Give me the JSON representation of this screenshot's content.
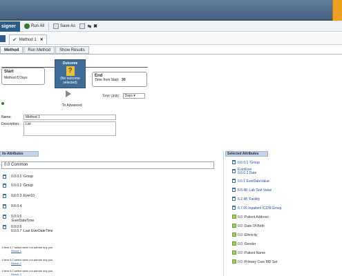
{
  "toolbar": {
    "designer_label": "signer",
    "run_all_label": "Run All",
    "save_as_label": "Save As"
  },
  "doc_tab": {
    "label": "Method 1"
  },
  "sub_tabs": [
    "Method",
    "Run Method",
    "Show Results"
  ],
  "flow": {
    "start_title": "Start",
    "start_sub": "Method 8 Days",
    "outcome_title": "Outcome",
    "outcome_sub": "(No outcome selected)",
    "end_title": "End",
    "end_sub_label": "Time from Start:",
    "end_sub_value": "30",
    "time_units_label": "Time Units:",
    "time_units_value": "Days",
    "to_advanced": "To Advanced"
  },
  "form": {
    "name_label": "Name:",
    "name_value": "Method 1",
    "description_label": "Description:",
    "description_value": "List"
  },
  "left_panel": {
    "title": "ilo Attributes",
    "search_value": "0.0 Common",
    "items": [
      "0.0.0.1 :Group",
      "0.0.0.2 :Group",
      "0.0.0.3 :Ever10",
      "0.0.0.4",
      "0.0.0.5\n:EverDateTime",
      "0.0.0.6\n0.0.0.7 :Last EverDateTime"
    ],
    "notes": [
      {
        "text": "1 Item 6.7 select seen not admire any pos",
        "link": "Result 1"
      },
      {
        "text": "1 Item 6.7 select seen not admire any pos",
        "link": "Result 2"
      },
      {
        "text": "1 Item 6.7 select seen not admire any pos",
        "link": "Result 3"
      }
    ]
  },
  "right_panel": {
    "title": "Selected Attributes",
    "items": [
      {
        "text": "0.0.0.1 :Group",
        "kind": "pin"
      },
      {
        "text": "EverEver\n0.0.0.2 Date",
        "kind": "pin"
      },
      {
        "text": "0.0.1 EverDateValue",
        "kind": "pin"
      },
      {
        "text": "6.6.48 :Lab Test Value",
        "kind": "pin"
      },
      {
        "text": "6.2.48 :Facility",
        "kind": "pin"
      },
      {
        "text": "6.7.06 Inpatient ICDN Group",
        "kind": "pin"
      },
      {
        "text": "0.0 :Patient Address",
        "kind": "green"
      },
      {
        "text": "0.0 :Date Of Birth",
        "kind": "green"
      },
      {
        "text": "0.0 :Ethnicity",
        "kind": "green"
      },
      {
        "text": "0.0 :Gender",
        "kind": "green"
      },
      {
        "text": "0.0 :Patient Name",
        "kind": "green"
      },
      {
        "text": "0.0 :Primary Care MD Set",
        "kind": "green"
      }
    ]
  }
}
